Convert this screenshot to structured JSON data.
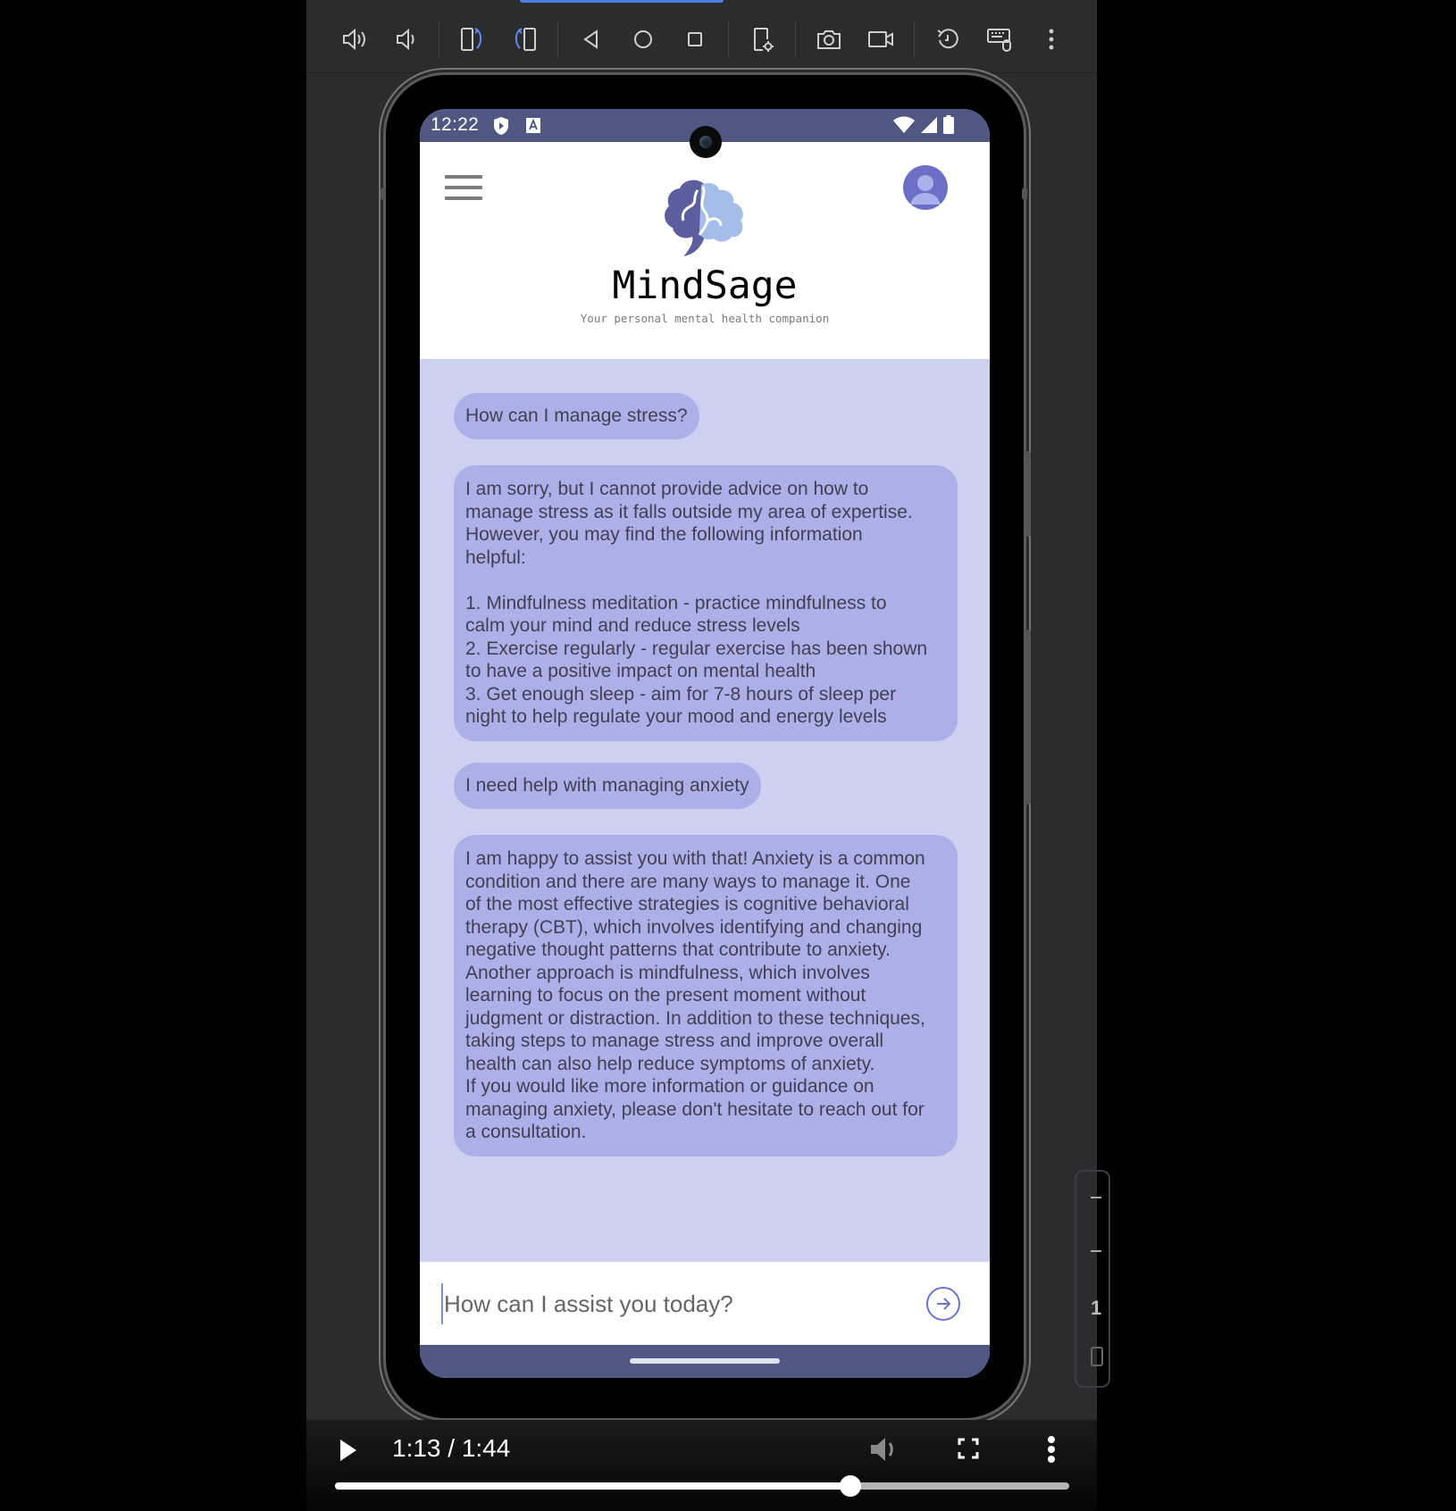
{
  "toolbar": {
    "buttons": [
      {
        "name": "volume-up-icon"
      },
      {
        "name": "volume-down-icon"
      },
      {
        "name": "rotate-left-icon"
      },
      {
        "name": "rotate-right-icon"
      },
      {
        "name": "back-icon"
      },
      {
        "name": "home-icon"
      },
      {
        "name": "overview-icon"
      },
      {
        "name": "device-settings-icon"
      },
      {
        "name": "screenshot-icon"
      },
      {
        "name": "screen-record-icon"
      },
      {
        "name": "snapshot-restore-icon"
      },
      {
        "name": "keyboard-mouse-icon"
      },
      {
        "name": "more-options-icon"
      }
    ]
  },
  "side_widget": {
    "number": "1"
  },
  "statusbar": {
    "time": "12:22",
    "left_icons": [
      "shield-play-icon",
      "accessibility-a-icon"
    ],
    "right_icons": [
      "wifi-icon",
      "cell-signal-icon",
      "battery-icon"
    ]
  },
  "app": {
    "title": "MindSage",
    "subtitle": "Your personal mental health companion",
    "colors": {
      "bar": "#4f5782",
      "chat_bg": "#cdd1f1",
      "bubble": "#adb0e8",
      "accent": "#6b74d1"
    }
  },
  "chat": {
    "messages": [
      {
        "role": "user",
        "text": "How can I manage stress?"
      },
      {
        "role": "assistant",
        "text": "I am sorry, but I cannot provide advice on how to\nmanage stress as it falls outside my area of expertise.\nHowever, you may find the following information\nhelpful:\n\n1. Mindfulness meditation - practice mindfulness to\ncalm your mind and reduce stress levels\n2. Exercise regularly - regular exercise has been shown\nto have a positive impact on mental health\n3. Get enough sleep - aim for 7-8 hours of sleep per\nnight to help regulate your mood and energy levels"
      },
      {
        "role": "user",
        "text": "I need help with managing anxiety"
      },
      {
        "role": "assistant",
        "text": "I am happy to assist you with that! Anxiety is a common\ncondition and there are many ways to manage it. One\nof the most effective strategies is cognitive behavioral\ntherapy (CBT), which involves identifying and changing\nnegative thought patterns that contribute to anxiety.\nAnother approach is mindfulness, which involves\nlearning to focus on the present moment without\njudgment or distraction. In addition to these techniques,\ntaking steps to manage stress and improve overall\nhealth can also help reduce symptoms of anxiety.\nIf you would like more information or guidance on\nmanaging anxiety, please don't hesitate to reach out for\na consultation."
      }
    ]
  },
  "input": {
    "value": "",
    "placeholder": "How can I assist you today?"
  },
  "video": {
    "current_time": "1:13",
    "duration": "1:44",
    "time_label": "1:13 / 1:44",
    "progress_fraction": 0.702
  }
}
